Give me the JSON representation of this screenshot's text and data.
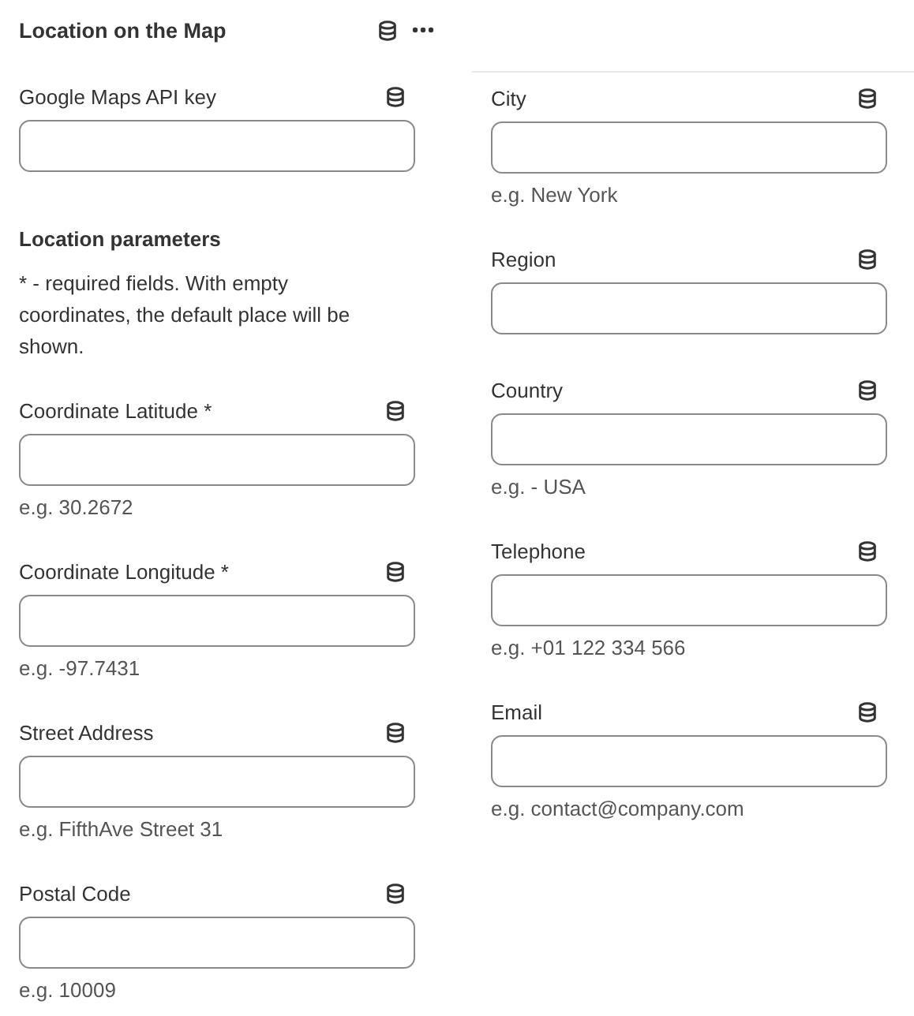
{
  "panel": {
    "title": "Location on the Map"
  },
  "api_field": {
    "label": "Google Maps API key"
  },
  "parameters": {
    "heading": "Location parameters",
    "description": "* - required fields. With empty coordinates, the default place will be shown."
  },
  "left_fields": [
    {
      "label": "Coordinate Latitude *",
      "hint": "e.g. 30.2672"
    },
    {
      "label": "Coordinate Longitude *",
      "hint": "e.g. -97.7431"
    },
    {
      "label": "Street Address",
      "hint": "e.g. FifthAve Street 31"
    },
    {
      "label": "Postal Code",
      "hint": "e.g. 10009"
    }
  ],
  "right_fields": [
    {
      "label": "City",
      "hint": "e.g. New York"
    },
    {
      "label": "Region"
    },
    {
      "label": "Country",
      "hint": "e.g. - USA"
    },
    {
      "label": "Telephone",
      "hint": "e.g. +01 122 334 566"
    },
    {
      "label": "Email",
      "hint": "e.g. contact@company.com"
    }
  ]
}
